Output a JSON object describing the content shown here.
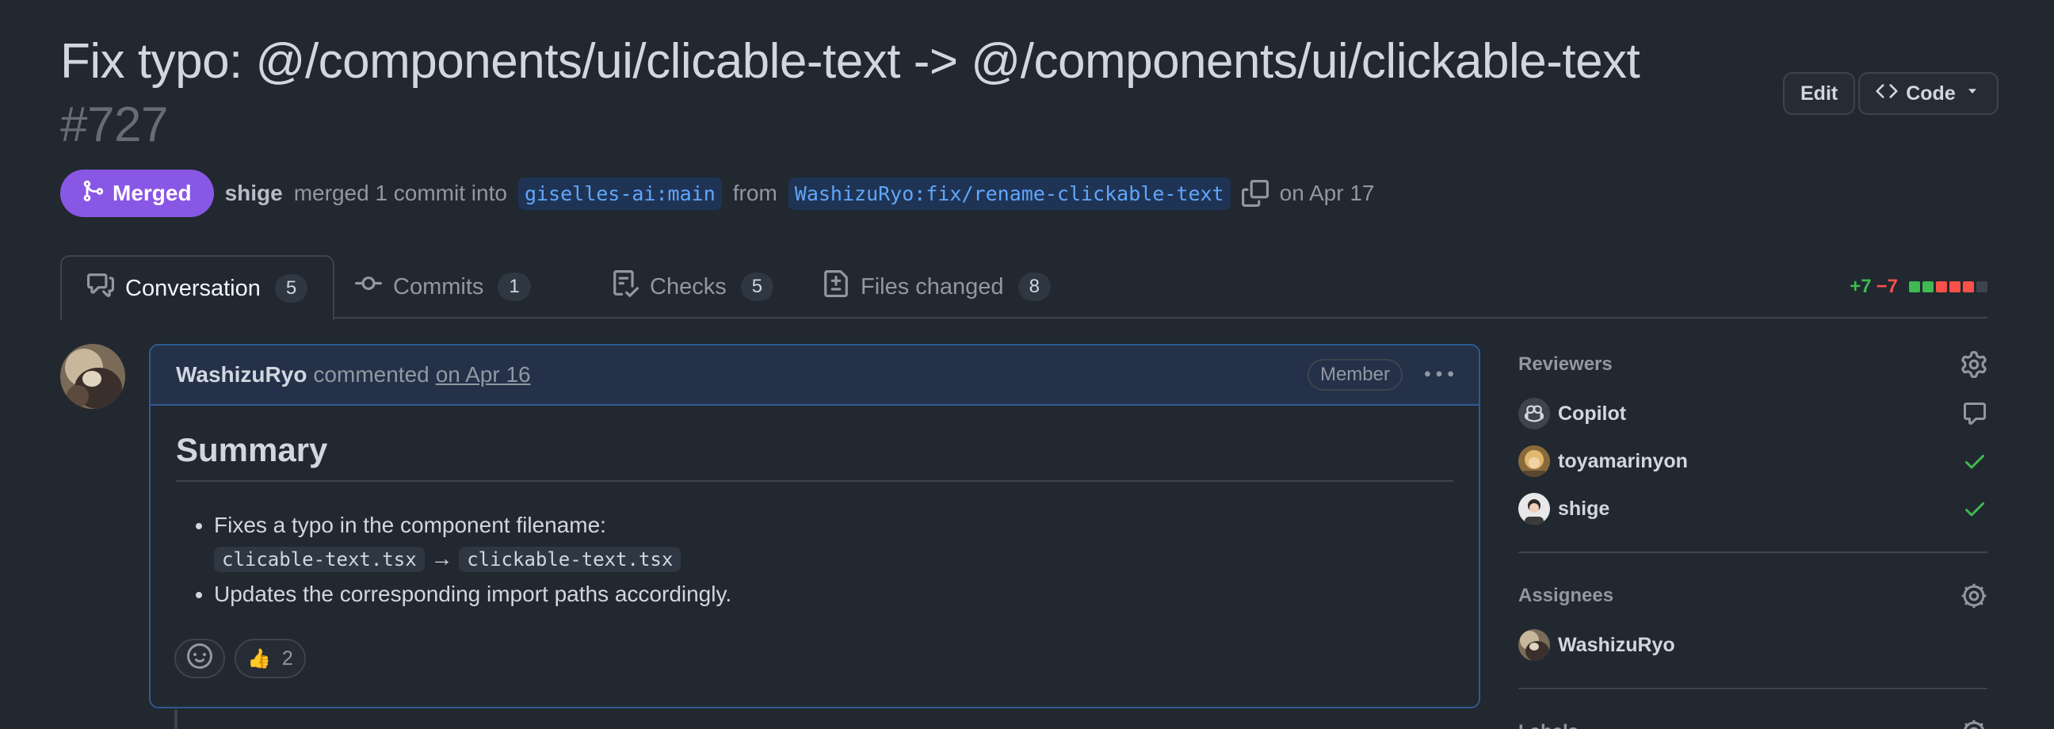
{
  "pr": {
    "title": "Fix typo: @/components/ui/clicable-text -> @/components/ui/clickable-text",
    "number": "#727",
    "state": "Merged",
    "author": "shige",
    "merge_text": "merged 1 commit into",
    "base_branch": "giselles-ai:main",
    "from_text": "from",
    "head_branch": "WashizuRyo:fix/rename-clickable-text",
    "date": "on Apr 17"
  },
  "header_actions": {
    "edit": "Edit",
    "code": "Code"
  },
  "tabs": [
    {
      "label": "Conversation",
      "count": "5",
      "icon": "comment-discussion-icon"
    },
    {
      "label": "Commits",
      "count": "1",
      "icon": "git-commit-icon"
    },
    {
      "label": "Checks",
      "count": "5",
      "icon": "checklist-icon"
    },
    {
      "label": "Files changed",
      "count": "8",
      "icon": "file-diff-icon"
    }
  ],
  "diffstat": {
    "additions": "+7",
    "deletions": "−7",
    "blocks": [
      "#3fb950",
      "#3fb950",
      "#f85149",
      "#f85149",
      "#f85149",
      "#3d444d"
    ]
  },
  "comment": {
    "author": "WashizuRyo",
    "action": "commented",
    "date": "on Apr 16",
    "role": "Member",
    "heading": "Summary",
    "item1_text": "Fixes a typo in the component filename:",
    "item1_code_from": "clicable-text.tsx",
    "item1_arrow": "→",
    "item1_code_to": "clickable-text.tsx",
    "item2_text": "Updates the corresponding import paths accordingly.",
    "reaction_emoji": "👍",
    "reaction_count": "2"
  },
  "sidebar": {
    "reviewers_title": "Reviewers",
    "reviewers": [
      {
        "name": "Copilot",
        "status_icon": "comment-icon"
      },
      {
        "name": "toyamarinyon",
        "status_icon": "check-icon"
      },
      {
        "name": "shige",
        "status_icon": "check-icon"
      }
    ],
    "assignees_title": "Assignees",
    "assignees": [
      {
        "name": "WashizuRyo"
      }
    ],
    "labels_title": "Labels"
  },
  "colors": {
    "background": "#212830",
    "merged": "#8957e5",
    "link": "#61a6fa",
    "success": "#3fb950",
    "danger": "#f85149"
  }
}
